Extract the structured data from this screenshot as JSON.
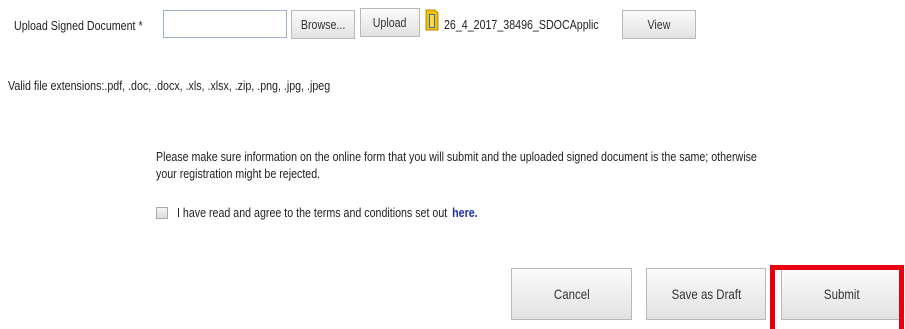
{
  "upload": {
    "label": "Upload Signed Document *",
    "file_input_value": "",
    "browse_label": "Browse...",
    "upload_label": "Upload",
    "file_icon": "document-file-icon",
    "file_name": "26_4_2017_38496_SDOCApplic",
    "view_label": "View"
  },
  "extensions_note": "Valid file extensions:.pdf, .doc, .docx, .xls, .xlsx, .zip, .png, .jpg, .jpeg",
  "notice": {
    "line1": "Please make sure information on the online form that you will submit and the uploaded signed document is the same; otherwise",
    "line2": "your registration might be rejected."
  },
  "agreement": {
    "checked": false,
    "text": "I have read and agree to the terms and conditions set out",
    "link_text": "here."
  },
  "actions": {
    "cancel_label": "Cancel",
    "save_draft_label": "Save as Draft",
    "submit_label": "Submit"
  },
  "colors": {
    "highlight": "#e8000f",
    "link": "#1f2fb0",
    "file_icon": "#f2c200"
  }
}
